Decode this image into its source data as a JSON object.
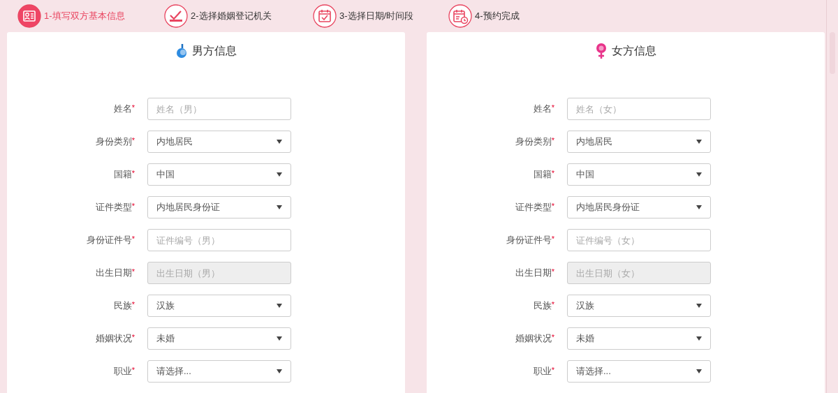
{
  "steps": [
    {
      "label": "1-填写双方基本信息",
      "selected": true
    },
    {
      "label": "2-选择婚姻登记机关",
      "selected": false
    },
    {
      "label": "3-选择日期/时间段",
      "selected": false
    },
    {
      "label": "4-预约完成",
      "selected": false
    }
  ],
  "panels": [
    {
      "title": "男方信息",
      "kind": "male",
      "fields": [
        {
          "label": "姓名",
          "mark": "*",
          "kind": "input",
          "disabled": false,
          "placeholder": "姓名（男）"
        },
        {
          "label": "身份类别",
          "mark": "*",
          "kind": "select",
          "value": "内地居民"
        },
        {
          "label": "国籍",
          "mark": "*",
          "kind": "select",
          "value": "中国"
        },
        {
          "label": "证件类型",
          "mark": "*",
          "kind": "select",
          "value": "内地居民身份证"
        },
        {
          "label": "身份证件号",
          "mark": "*",
          "kind": "input",
          "disabled": false,
          "placeholder": "证件编号（男）"
        },
        {
          "label": "出生日期",
          "mark": "*",
          "kind": "input",
          "disabled": true,
          "placeholder": "出生日期（男）"
        },
        {
          "label": "民族",
          "mark": "*",
          "kind": "select",
          "value": "汉族"
        },
        {
          "label": "婚姻状况",
          "mark": "*",
          "kind": "select",
          "value": "未婚"
        },
        {
          "label": "职业",
          "mark": "*",
          "kind": "select",
          "value": "请选择..."
        }
      ]
    },
    {
      "title": "女方信息",
      "kind": "female",
      "fields": [
        {
          "label": "姓名",
          "mark": "*",
          "kind": "input",
          "disabled": false,
          "placeholder": "姓名（女）"
        },
        {
          "label": "身份类别",
          "mark": "*",
          "kind": "select",
          "value": "内地居民"
        },
        {
          "label": "国籍",
          "mark": "*",
          "kind": "select",
          "value": "中国"
        },
        {
          "label": "证件类型",
          "mark": "*",
          "kind": "select",
          "value": "内地居民身份证"
        },
        {
          "label": "身份证件号",
          "mark": "*",
          "kind": "input",
          "disabled": false,
          "placeholder": "证件编号（女）"
        },
        {
          "label": "出生日期",
          "mark": "*",
          "kind": "input",
          "disabled": true,
          "placeholder": "出生日期（女）"
        },
        {
          "label": "民族",
          "mark": "*",
          "kind": "select",
          "value": "汉族"
        },
        {
          "label": "婚姻状况",
          "mark": "*",
          "kind": "select",
          "value": "未婚"
        },
        {
          "label": "职业",
          "mark": "*",
          "kind": "select",
          "value": "请选择..."
        }
      ]
    }
  ]
}
